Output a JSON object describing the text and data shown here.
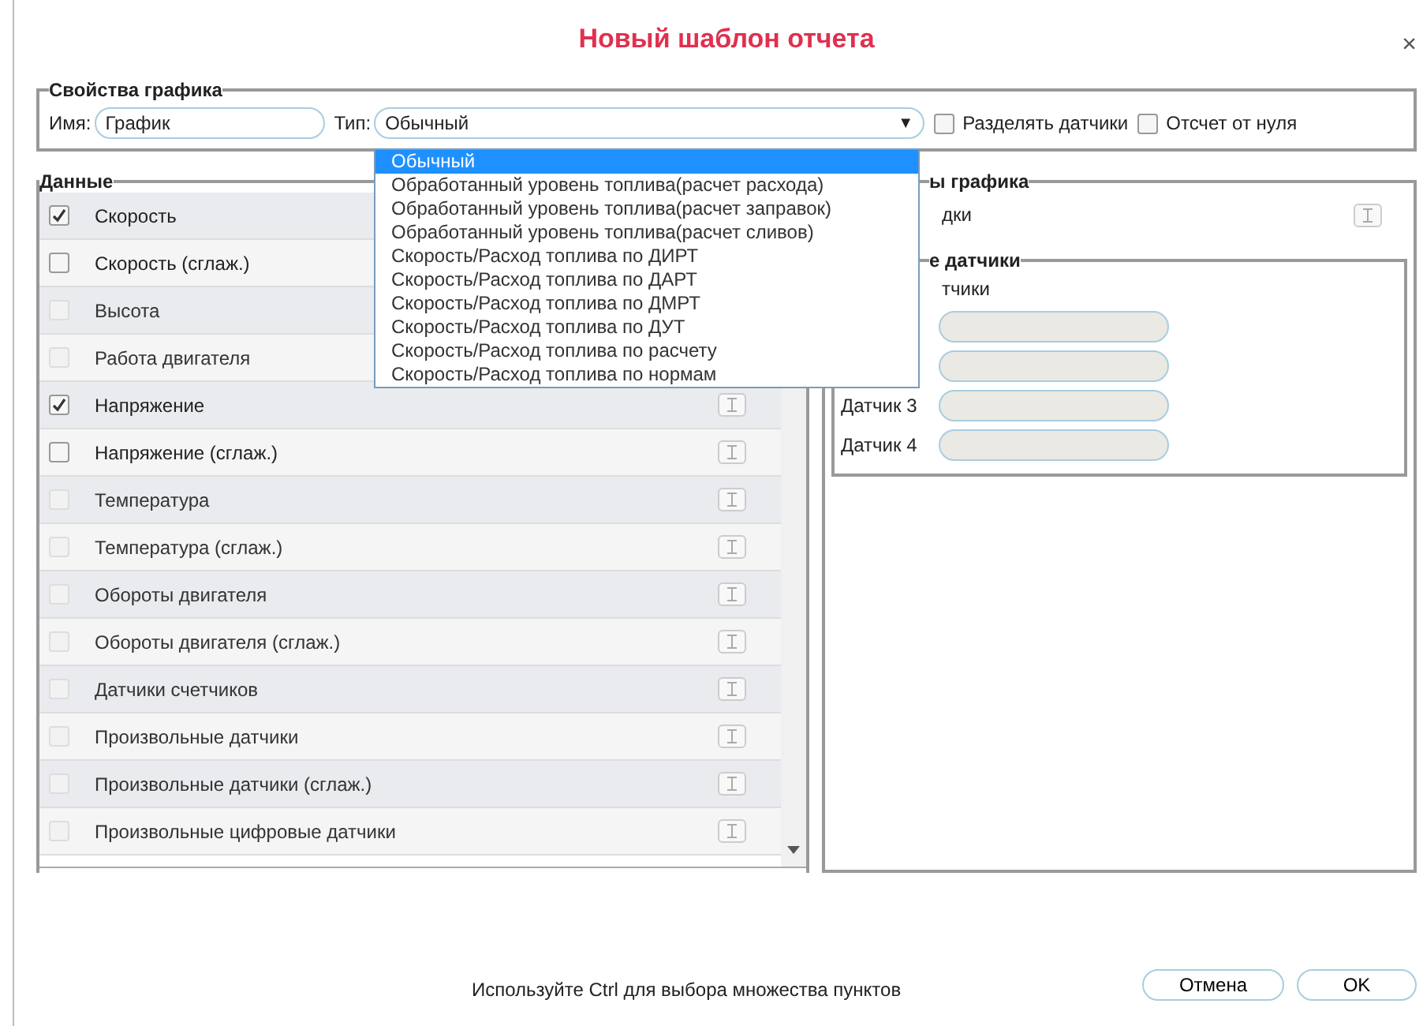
{
  "dialog": {
    "title": "Новый шаблон отчета",
    "close": "×"
  },
  "graph_properties": {
    "legend": "Свойства графика",
    "name_label": "Имя:",
    "name_value": "График",
    "type_label": "Тип:",
    "type_value": "Обычный",
    "arrow": "▼",
    "options": [
      {
        "label": "Разделять датчики",
        "checked": false
      },
      {
        "label": "Отсчет от нуля",
        "checked": false
      }
    ]
  },
  "type_dropdown": [
    {
      "label": "Обычный",
      "selected": true
    },
    {
      "label": "Обработанный уровень топлива(расчет расхода)",
      "selected": false
    },
    {
      "label": "Обработанный уровень топлива(расчет заправок)",
      "selected": false
    },
    {
      "label": "Обработанный уровень топлива(расчет сливов)",
      "selected": false
    },
    {
      "label": "Скорость/Расход топлива по ДИРТ",
      "selected": false
    },
    {
      "label": "Скорость/Расход топлива по ДАРТ",
      "selected": false
    },
    {
      "label": "Скорость/Расход топлива по ДМРТ",
      "selected": false
    },
    {
      "label": "Скорость/Расход топлива по ДУТ",
      "selected": false
    },
    {
      "label": "Скорость/Расход топлива по расчету",
      "selected": false
    },
    {
      "label": "Скорость/Расход топлива по нормам",
      "selected": false
    }
  ],
  "data": {
    "legend": "Данные",
    "rows": [
      {
        "label": "Скорость",
        "checked": true,
        "disabled": false
      },
      {
        "label": "Скорость (сглаж.)",
        "checked": false,
        "disabled": false
      },
      {
        "label": "Высота",
        "checked": false,
        "disabled": true
      },
      {
        "label": "Работа двигателя",
        "checked": false,
        "disabled": true
      },
      {
        "label": "Напряжение",
        "checked": true,
        "disabled": false,
        "info_icon": true
      },
      {
        "label": "Напряжение (сглаж.)",
        "checked": false,
        "disabled": false,
        "info_icon": true
      },
      {
        "label": "Температура",
        "checked": false,
        "disabled": true,
        "info_icon": true
      },
      {
        "label": "Температура (сглаж.)",
        "checked": false,
        "disabled": true,
        "info_icon": true
      },
      {
        "label": "Обороты двигателя",
        "checked": false,
        "disabled": true,
        "info_icon": true
      },
      {
        "label": "Обороты двигателя (сглаж.)",
        "checked": false,
        "disabled": true,
        "info_icon": true
      },
      {
        "label": "Датчики счетчиков",
        "checked": false,
        "disabled": true,
        "info_icon": true
      },
      {
        "label": "Произвольные датчики",
        "checked": false,
        "disabled": true,
        "info_icon": true
      },
      {
        "label": "Произвольные датчики (сглаж.)",
        "checked": false,
        "disabled": true,
        "info_icon": true
      },
      {
        "label": "Произвольные цифровые датчики",
        "checked": false,
        "disabled": true,
        "info_icon": true
      }
    ]
  },
  "chart_params": {
    "legend": "ы графика",
    "hint_label": "дки",
    "sensors": {
      "legend": "е датчики",
      "label": "тчики",
      "fields": [
        {
          "kind": "unlabeled"
        },
        {
          "kind": "unlabeled"
        },
        {
          "kind": "labeled",
          "label": "Датчик 3"
        },
        {
          "kind": "labeled",
          "label": "Датчик 4"
        }
      ]
    }
  },
  "footer": {
    "hint": "Используйте Ctrl для выбора множества пунктов",
    "buttons": [
      "Отмена",
      "OK"
    ]
  }
}
